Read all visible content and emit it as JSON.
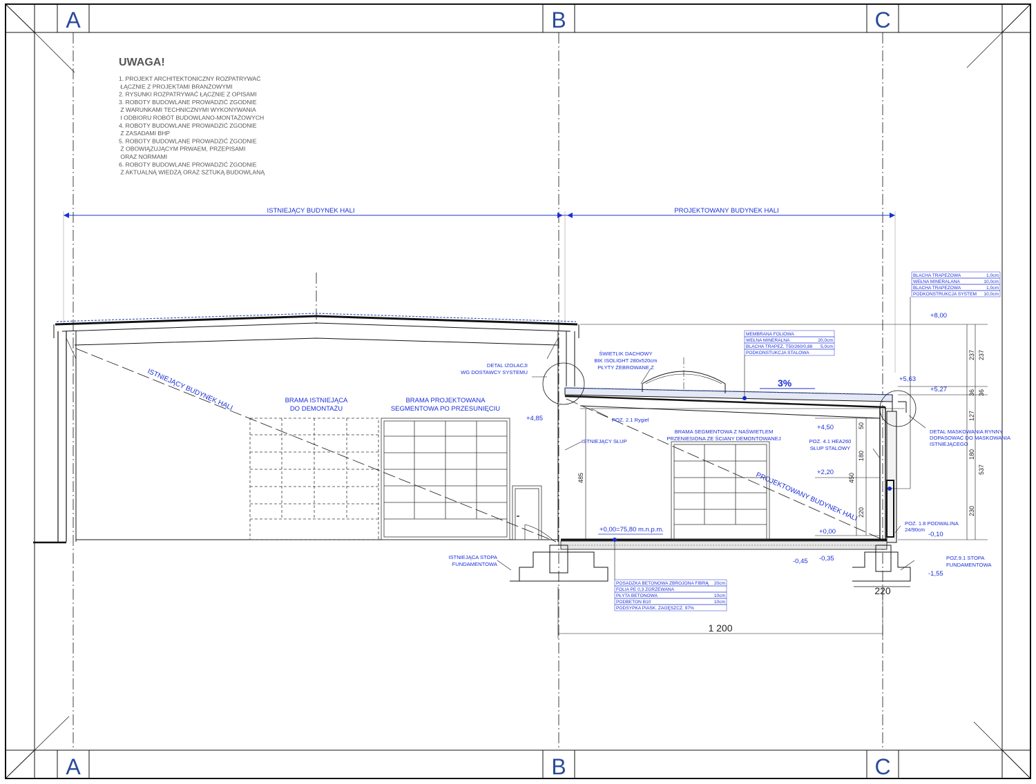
{
  "grid": {
    "axes": [
      "A",
      "B",
      "C"
    ]
  },
  "notes": {
    "title": "UWAGA!",
    "lines": [
      "1. PROJEKT ARCHITEKTONICZNY ROZPATRYWAĆ",
      "   ŁĄCZNIE Z PROJEKTAMI BRANŻOWYMI",
      "2. RYSUNKI ROZPATRYWAĆ ŁĄCZNIE Z OPISAMI",
      "3. ROBOTY BUDOWLANE PROWADZIĆ ZGODNIE",
      "    Z WARUNKAMI TECHNICZNYMI WYKONYWANIA",
      "    I ODBIORU ROBÓT BUDOWLANO-MONTAŻOWYCH",
      "4. ROBOTY BUDOWLANE PROWADZIĆ ZGODNIE",
      "    Z ZASADAMI BHP",
      "5. ROBOTY BUDOWLANE PROWADZIĆ ZGODNIE",
      "    Z OBOWIĄZUJĄCYM PRWAEM, PRZEPISAMI",
      "    ORAZ NORMAMI",
      "6. ROBOTY BUDOWLANE PROWADZIĆ ZGODNIE",
      "    Z AKTUALNĄ WIEDZĄ ORAZ SZTUKĄ BUDOWLANĄ"
    ]
  },
  "zones": {
    "existing": "ISTNIEJĄCY BUDYNEK HALI",
    "designed": "PROJEKTOWANY BUDYNEK HALI"
  },
  "diagonals": {
    "existing": "ISTNIEJĄCY BUDYNEK  HALI",
    "designed": "PROJEKTOWANY BUDYNEK HALI"
  },
  "gates": {
    "existing": [
      "BRAMA ISTNIEJĄCA",
      "DO DEMONTAŻU"
    ],
    "designed": [
      "BRAMA PROJEKTOWANA",
      "SEGMENTOWA PO PRZESUNIĘCIU"
    ],
    "moved": [
      "BRAMA SEGMENTOWA Z NAŚWIETLEM",
      "PRZENIESIONA ZE ŚCIANY DEMONTOWANEJ"
    ]
  },
  "labels": {
    "insulation_detail": [
      "DETAL IZOLACJI",
      "WG DOSTAWCY SYSTEMU"
    ],
    "skylight": [
      "ŚWIETLIK DACHOWY",
      "BIK ISOLIGHT 280x520cm",
      "PŁYTY ŻEBROWANE Z"
    ],
    "beam": "POZ. 2.1 Rygiel",
    "existing_column": "ISTNIEJĄCY SŁUP",
    "steel_column": [
      "POZ. 4.1 HEA260",
      "SŁUP STALOWY"
    ],
    "gutter_detail": [
      "DETAL MASKOWANIA RYNNY",
      "DOPASOWAĆ DO MASKOWANIA",
      "ISTNIEJĄCEGO"
    ],
    "plinth": [
      "POZ. 1.8 PODWALINA",
      "24/90cm"
    ],
    "existing_footing": [
      "ISTNIEJĄCA STOPA",
      "FUNDAMENTOWA"
    ],
    "new_footing": [
      "POZ.9.1 STOPA",
      "FUNDAMENTOWA"
    ],
    "slope": "3%",
    "zero_level": "+0,00=75,80 m.n.p.m."
  },
  "levels": [
    "+8,00",
    "+5,63",
    "+5,27",
    "+4,85",
    "+4,50",
    "+2,20",
    "+0,00",
    "-0,10",
    "-0,45",
    "-0,35",
    "-1,55"
  ],
  "dimensions": {
    "span": "1 200",
    "footing": "220",
    "height_485": "485",
    "inner": [
      "50",
      "180",
      "220",
      "450"
    ],
    "right_outer": [
      "237",
      "36",
      "127",
      "180",
      "230"
    ],
    "right_total": [
      "237",
      "36",
      "537"
    ]
  },
  "layers": {
    "wall": [
      {
        "name": "BLACHA TRAPEZOWA",
        "value": "1,0cm"
      },
      {
        "name": "WEŁNA MINERALANA",
        "value": "10,0cm"
      },
      {
        "name": "BLACHA TRAPEZOWA",
        "value": "1,0cm"
      },
      {
        "name": "PODKONSTRUKCJA SYSTEM",
        "value": "10,0cm"
      }
    ],
    "roof": [
      {
        "name": "MEMBRANA FOLIOWA",
        "value": ""
      },
      {
        "name": "WEŁNA MINERALNA",
        "value": "20,0cm"
      },
      {
        "name": "BLACHA TRAPEZ. T50/260/0,88",
        "value": "5,0cm"
      },
      {
        "name": "PODKONSTUKCJA STALOWA",
        "value": ""
      }
    ],
    "floor": [
      {
        "name": "POSADZKA BETONOWA ZBROJONA FIBRĄ",
        "value": "20cm"
      },
      {
        "name": "FOLIA PE 0,3 ZGRZEWANA",
        "value": ""
      },
      {
        "name": "PŁYTA BETONOWA",
        "value": "10cm"
      },
      {
        "name": "PODBETON B10",
        "value": "10cm"
      },
      {
        "name": "PODSYPKA PIASK. ZAGĘSZCZ. 97%",
        "value": ""
      }
    ]
  },
  "colors": {
    "annotation": "#1a2fd6",
    "line": "#111111",
    "muted": "#555555"
  }
}
